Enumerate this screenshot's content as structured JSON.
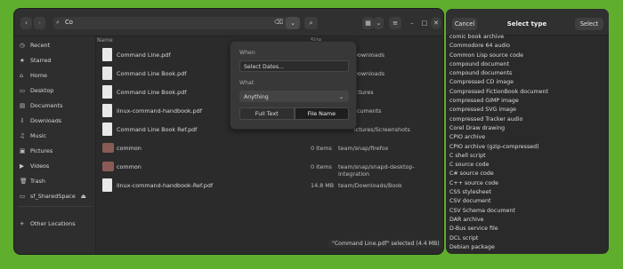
{
  "header": {
    "back_icon": "‹",
    "forward_icon": "›",
    "search_text": "Co",
    "filter_icon": "⌄",
    "search_icon": "⌕",
    "grid_icon": "▦",
    "view_caret": "⌄",
    "menu_icon": "≡",
    "minimize": "–",
    "maximize": "□",
    "close": "✕"
  },
  "sidebar": {
    "items": [
      {
        "icon": "◷",
        "label": "Recent"
      },
      {
        "icon": "★",
        "label": "Starred"
      },
      {
        "icon": "⌂",
        "label": "Home"
      },
      {
        "icon": "▭",
        "label": "Desktop"
      },
      {
        "icon": "▤",
        "label": "Documents"
      },
      {
        "icon": "⇩",
        "label": "Downloads"
      },
      {
        "icon": "♫",
        "label": "Music"
      },
      {
        "icon": "▣",
        "label": "Pictures"
      },
      {
        "icon": "▶",
        "label": "Videos"
      },
      {
        "icon": "🗑",
        "label": "Trash"
      },
      {
        "icon": "▭",
        "label": "sf_SharedSpace",
        "eject": "⏏"
      }
    ],
    "other": {
      "icon": "+",
      "label": "Other Locations"
    }
  },
  "columns": {
    "name": "Name",
    "size": "Size"
  },
  "files": [
    {
      "name": "Command Line.pdf",
      "size": "",
      "location": "Downloads",
      "kind": "doc"
    },
    {
      "name": "Command Line Book.pdf",
      "size": "",
      "location": "Downloads",
      "kind": "doc"
    },
    {
      "name": "Command Line Book.pdf",
      "size": "",
      "location": "ictures",
      "kind": "doc"
    },
    {
      "name": "linux-command-handbook.pdf",
      "size": "",
      "location": "ocuments",
      "kind": "doc"
    },
    {
      "name": "Command Line Book Ref.pdf",
      "size": "",
      "location": "ictures/Screenshots",
      "kind": "doc"
    },
    {
      "name": "common",
      "size": "0 items",
      "location": "team/snap/firefox",
      "kind": "folder"
    },
    {
      "name": "common",
      "size": "0 items",
      "location": "team/snap/snapd-desktop-integration",
      "kind": "folder"
    },
    {
      "name": "linux-command-handbook-Ref.pdf",
      "size": "14.8 MB",
      "location": "team/Downloads/Book",
      "kind": "doc"
    }
  ],
  "popover": {
    "when_label": "When",
    "dates_placeholder": "Select Dates...",
    "what_label": "What",
    "what_value": "Anything",
    "full_text": "Full Text",
    "file_name": "File Name"
  },
  "status": "\"Command Line.pdf\" selected  (4.4 MB)",
  "dialog": {
    "cancel": "Cancel",
    "title": "Select type",
    "select": "Select",
    "types": [
      "comic book archive",
      "Commodore 64 audio",
      "Common Lisp source code",
      "compound document",
      "compound documents",
      "Compressed CD image",
      "Compressed FictionBook document",
      "compressed GIMP image",
      "compressed SVG image",
      "compressed Tracker audio",
      "Corel Draw drawing",
      "CPIO archive",
      "CPIO archive (gzip-compressed)",
      "C shell script",
      "C source code",
      "C# source code",
      "C++ source code",
      "CSS stylesheet",
      "CSV document",
      "CSV Schema document",
      "DAR archive",
      "D-Bus service file",
      "DCL script",
      "Debian package"
    ]
  }
}
